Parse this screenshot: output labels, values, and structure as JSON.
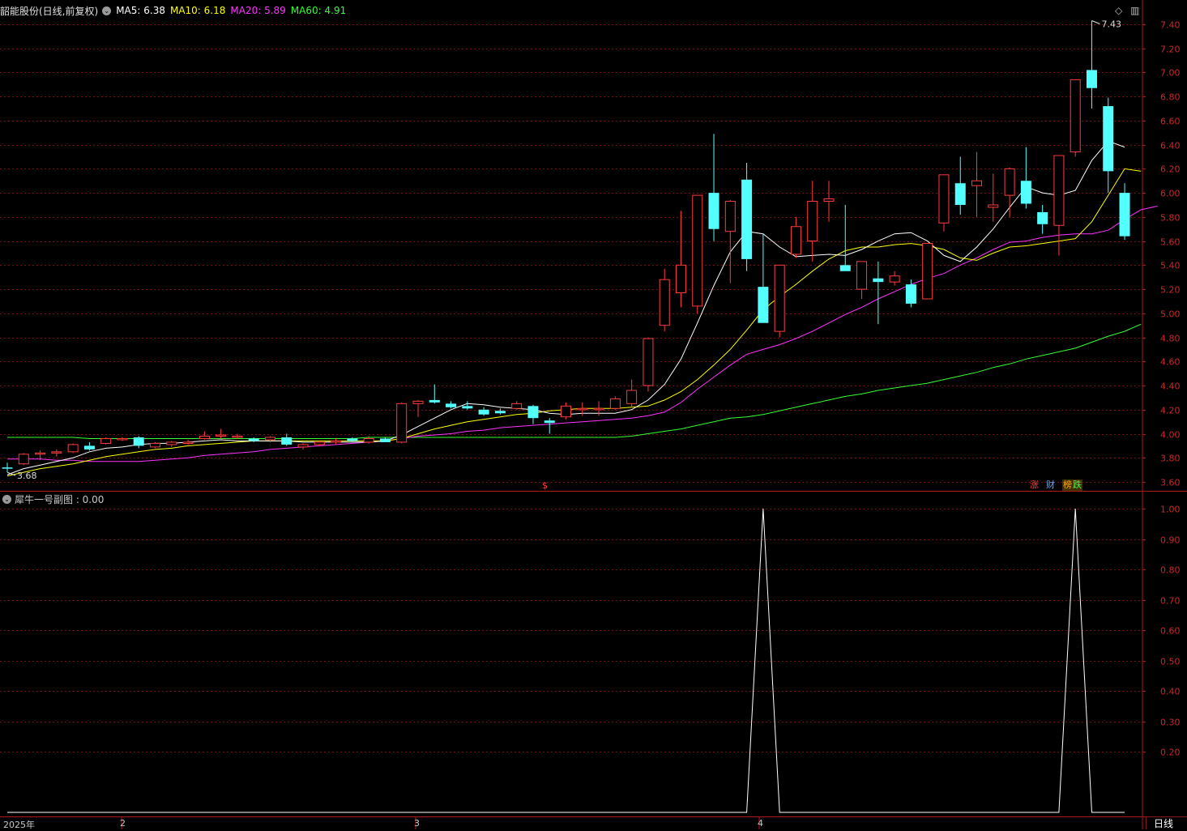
{
  "main": {
    "title": "韶能股份(日线,前复权)",
    "ma": [
      {
        "label": "MA5: 6.38",
        "color": "#ffffff"
      },
      {
        "label": "MA10: 6.18",
        "color": "#ffff00"
      },
      {
        "label": "MA20: 5.89",
        "color": "#ff33ff"
      },
      {
        "label": "MA60: 4.91",
        "color": "#33ff33"
      }
    ],
    "high_mark": "7.43",
    "low_mark": "3.68",
    "badges": [
      {
        "label": "涨",
        "color": "#ff4040",
        "bg": "#3a0000"
      },
      {
        "label": "财",
        "color": "#66aaff",
        "bg": "#001040"
      },
      {
        "label": "榜",
        "color": "#ffaa00",
        "bg": "#403000"
      },
      {
        "label": "跌",
        "color": "#40ff40",
        "bg": "#003a00"
      }
    ],
    "event_marker": "$"
  },
  "sub": {
    "title": "犀牛一号副图 : 0.00"
  },
  "xaxis": {
    "labels": [
      "2025年",
      "2",
      "3",
      "4"
    ]
  },
  "period_tab": "日线",
  "colors": {
    "up": "#ff3c3c",
    "down": "#54ffff",
    "grid": "#7a1010",
    "axis": "#b01818",
    "axis_text": "#c82828",
    "indicator": "#ffffff"
  },
  "chart_data": [
    {
      "type": "candlestick",
      "title": "韶能股份(日线,前复权)",
      "y_ticks": [
        "7.40",
        "7.20",
        "7.00",
        "6.80",
        "6.60",
        "6.40",
        "6.20",
        "6.00",
        "5.80",
        "5.60",
        "5.40",
        "5.20",
        "5.00",
        "4.80",
        "4.60",
        "4.40",
        "4.20",
        "4.00",
        "3.80",
        "3.60"
      ],
      "ylim": [
        3.58,
        7.5
      ],
      "candles": [
        [
          3.72,
          3.76,
          3.68,
          3.71
        ],
        [
          3.75,
          3.84,
          3.74,
          3.83
        ],
        [
          3.83,
          3.86,
          3.78,
          3.84
        ],
        [
          3.84,
          3.87,
          3.81,
          3.85
        ],
        [
          3.85,
          3.92,
          3.84,
          3.91
        ],
        [
          3.9,
          3.93,
          3.86,
          3.87
        ],
        [
          3.92,
          3.97,
          3.91,
          3.96
        ],
        [
          3.96,
          3.97,
          3.94,
          3.96
        ],
        [
          3.97,
          3.98,
          3.88,
          3.9
        ],
        [
          3.89,
          3.93,
          3.88,
          3.92
        ],
        [
          3.91,
          3.94,
          3.89,
          3.93
        ],
        [
          3.92,
          3.95,
          3.91,
          3.93
        ],
        [
          3.96,
          4.02,
          3.95,
          3.98
        ],
        [
          3.99,
          4.04,
          3.96,
          3.99
        ],
        [
          3.98,
          4.0,
          3.96,
          3.98
        ],
        [
          3.96,
          3.97,
          3.93,
          3.94
        ],
        [
          3.95,
          3.98,
          3.93,
          3.97
        ],
        [
          3.97,
          4.0,
          3.9,
          3.91
        ],
        [
          3.89,
          3.92,
          3.87,
          3.91
        ],
        [
          3.91,
          3.94,
          3.9,
          3.93
        ],
        [
          3.93,
          3.96,
          3.91,
          3.94
        ],
        [
          3.96,
          3.97,
          3.93,
          3.94
        ],
        [
          3.93,
          3.98,
          3.92,
          3.96
        ],
        [
          3.96,
          3.97,
          3.93,
          3.93
        ],
        [
          3.93,
          4.26,
          3.92,
          4.25
        ],
        [
          4.25,
          4.28,
          4.14,
          4.27
        ],
        [
          4.28,
          4.41,
          4.25,
          4.26
        ],
        [
          4.25,
          4.27,
          4.21,
          4.22
        ],
        [
          4.23,
          4.27,
          4.2,
          4.21
        ],
        [
          4.2,
          4.22,
          4.15,
          4.16
        ],
        [
          4.19,
          4.21,
          4.16,
          4.17
        ],
        [
          4.21,
          4.27,
          4.2,
          4.25
        ],
        [
          4.23,
          4.24,
          4.08,
          4.13
        ],
        [
          4.11,
          4.13,
          4.0,
          4.09
        ],
        [
          4.14,
          4.26,
          4.12,
          4.23
        ],
        [
          4.2,
          4.26,
          4.15,
          4.21
        ],
        [
          4.2,
          4.27,
          4.15,
          4.21
        ],
        [
          4.21,
          4.31,
          4.2,
          4.29
        ],
        [
          4.25,
          4.45,
          4.22,
          4.36
        ],
        [
          4.4,
          4.8,
          4.35,
          4.79
        ],
        [
          4.9,
          5.37,
          4.85,
          5.28
        ],
        [
          5.17,
          5.85,
          5.05,
          5.4
        ],
        [
          5.06,
          5.98,
          5.0,
          5.98
        ],
        [
          6.0,
          6.49,
          5.6,
          5.7
        ],
        [
          5.68,
          5.94,
          5.25,
          5.93
        ],
        [
          6.11,
          6.25,
          5.35,
          5.45
        ],
        [
          5.22,
          5.66,
          4.92,
          4.92
        ],
        [
          4.85,
          5.4,
          4.8,
          5.4
        ],
        [
          5.49,
          5.8,
          5.46,
          5.72
        ],
        [
          5.6,
          6.1,
          5.43,
          5.93
        ],
        [
          5.93,
          6.1,
          5.76,
          5.95
        ],
        [
          5.4,
          5.9,
          5.35,
          5.35
        ],
        [
          5.2,
          5.42,
          5.12,
          5.43
        ],
        [
          5.29,
          5.43,
          4.91,
          5.26
        ],
        [
          5.26,
          5.35,
          5.23,
          5.31
        ],
        [
          5.24,
          5.28,
          5.05,
          5.08
        ],
        [
          5.12,
          5.58,
          5.12,
          5.58
        ],
        [
          5.75,
          6.14,
          5.68,
          6.15
        ],
        [
          6.08,
          6.3,
          5.82,
          5.9
        ],
        [
          6.06,
          6.34,
          5.8,
          6.1
        ],
        [
          5.88,
          6.16,
          5.76,
          5.9
        ],
        [
          5.98,
          6.21,
          5.8,
          6.2
        ],
        [
          6.1,
          6.38,
          5.87,
          5.91
        ],
        [
          5.84,
          5.9,
          5.66,
          5.74
        ],
        [
          5.73,
          6.31,
          5.48,
          6.31
        ],
        [
          6.34,
          6.94,
          6.3,
          6.94
        ],
        [
          7.02,
          7.43,
          6.7,
          6.87
        ],
        [
          6.72,
          6.79,
          6.0,
          6.18
        ],
        [
          6.0,
          6.08,
          5.61,
          5.64
        ]
      ],
      "ma5": [
        3.66,
        3.71,
        3.74,
        3.77,
        3.8,
        3.85,
        3.88,
        3.89,
        3.91,
        3.92,
        3.92,
        3.93,
        3.94,
        3.95,
        3.94,
        3.94,
        3.94,
        3.94,
        3.93,
        3.93,
        3.93,
        3.93,
        3.93,
        3.94,
        3.99,
        4.06,
        4.13,
        4.2,
        4.25,
        4.24,
        4.22,
        4.21,
        4.2,
        4.17,
        4.16,
        4.17,
        4.17,
        4.17,
        4.2,
        4.28,
        4.41,
        4.62,
        4.92,
        5.23,
        5.51,
        5.68,
        5.66,
        5.55,
        5.47,
        5.48,
        5.49,
        5.48,
        5.53,
        5.6,
        5.66,
        5.67,
        5.6,
        5.48,
        5.43,
        5.55,
        5.7,
        5.88,
        6.05,
        6.0,
        5.98,
        6.02,
        6.27,
        6.43,
        6.38
      ],
      "ma10": [
        3.65,
        3.68,
        3.71,
        3.73,
        3.75,
        3.78,
        3.81,
        3.83,
        3.85,
        3.87,
        3.88,
        3.9,
        3.91,
        3.92,
        3.93,
        3.94,
        3.94,
        3.94,
        3.94,
        3.94,
        3.94,
        3.94,
        3.94,
        3.94,
        3.96,
        4.0,
        4.04,
        4.07,
        4.1,
        4.12,
        4.14,
        4.16,
        4.17,
        4.19,
        4.2,
        4.21,
        4.21,
        4.21,
        4.22,
        4.23,
        4.28,
        4.35,
        4.45,
        4.57,
        4.7,
        4.86,
        5.03,
        5.14,
        5.24,
        5.35,
        5.45,
        5.52,
        5.55,
        5.55,
        5.57,
        5.58,
        5.56,
        5.53,
        5.46,
        5.44,
        5.5,
        5.55,
        5.56,
        5.58,
        5.6,
        5.62,
        5.76,
        5.98,
        6.2,
        6.18
      ],
      "ma20": [
        3.79,
        3.79,
        3.79,
        3.78,
        3.78,
        3.77,
        3.77,
        3.77,
        3.77,
        3.78,
        3.79,
        3.8,
        3.82,
        3.83,
        3.84,
        3.85,
        3.87,
        3.88,
        3.89,
        3.9,
        3.91,
        3.92,
        3.93,
        3.94,
        3.96,
        3.98,
        3.99,
        4.0,
        4.02,
        4.03,
        4.05,
        4.06,
        4.07,
        4.08,
        4.09,
        4.1,
        4.11,
        4.12,
        4.13,
        4.15,
        4.18,
        4.26,
        4.37,
        4.47,
        4.57,
        4.66,
        4.7,
        4.74,
        4.79,
        4.85,
        4.92,
        4.99,
        5.05,
        5.12,
        5.18,
        5.24,
        5.29,
        5.33,
        5.4,
        5.46,
        5.53,
        5.59,
        5.6,
        5.63,
        5.65,
        5.66,
        5.66,
        5.69,
        5.78,
        5.86,
        5.89
      ],
      "ma60": [
        3.97,
        3.97,
        3.97,
        3.97,
        3.97,
        3.96,
        3.96,
        3.96,
        3.96,
        3.96,
        3.96,
        3.96,
        3.96,
        3.96,
        3.96,
        3.96,
        3.96,
        3.96,
        3.96,
        3.96,
        3.96,
        3.96,
        3.97,
        3.97,
        3.97,
        3.97,
        3.97,
        3.97,
        3.97,
        3.97,
        3.97,
        3.97,
        3.97,
        3.97,
        3.97,
        3.97,
        3.97,
        3.97,
        3.98,
        4.0,
        4.02,
        4.04,
        4.07,
        4.1,
        4.13,
        4.14,
        4.16,
        4.19,
        4.22,
        4.25,
        4.28,
        4.31,
        4.33,
        4.36,
        4.38,
        4.4,
        4.42,
        4.45,
        4.48,
        4.51,
        4.55,
        4.58,
        4.62,
        4.65,
        4.68,
        4.71,
        4.76,
        4.81,
        4.85,
        4.91
      ]
    },
    {
      "type": "line",
      "title": "犀牛一号副图 : 0.00",
      "y_ticks": [
        "1.00",
        "0.90",
        "0.80",
        "0.70",
        "0.60",
        "0.50",
        "0.40",
        "0.30",
        "0.20"
      ],
      "ylim": [
        0,
        1
      ],
      "series": [
        {
          "values": [
            0,
            0,
            0,
            0,
            0,
            0,
            0,
            0,
            0,
            0,
            0,
            0,
            0,
            0,
            0,
            0,
            0,
            0,
            0,
            0,
            0,
            0,
            0,
            0,
            0,
            0,
            0,
            0,
            0,
            0,
            0,
            0,
            0,
            0,
            0,
            0,
            0,
            0,
            0,
            0,
            0,
            0,
            0,
            0,
            0,
            0,
            1,
            0,
            0,
            0,
            0,
            0,
            0,
            0,
            0,
            0,
            0,
            0,
            0,
            0,
            0,
            0,
            0,
            0,
            0,
            1,
            0,
            0,
            0
          ]
        }
      ]
    }
  ]
}
